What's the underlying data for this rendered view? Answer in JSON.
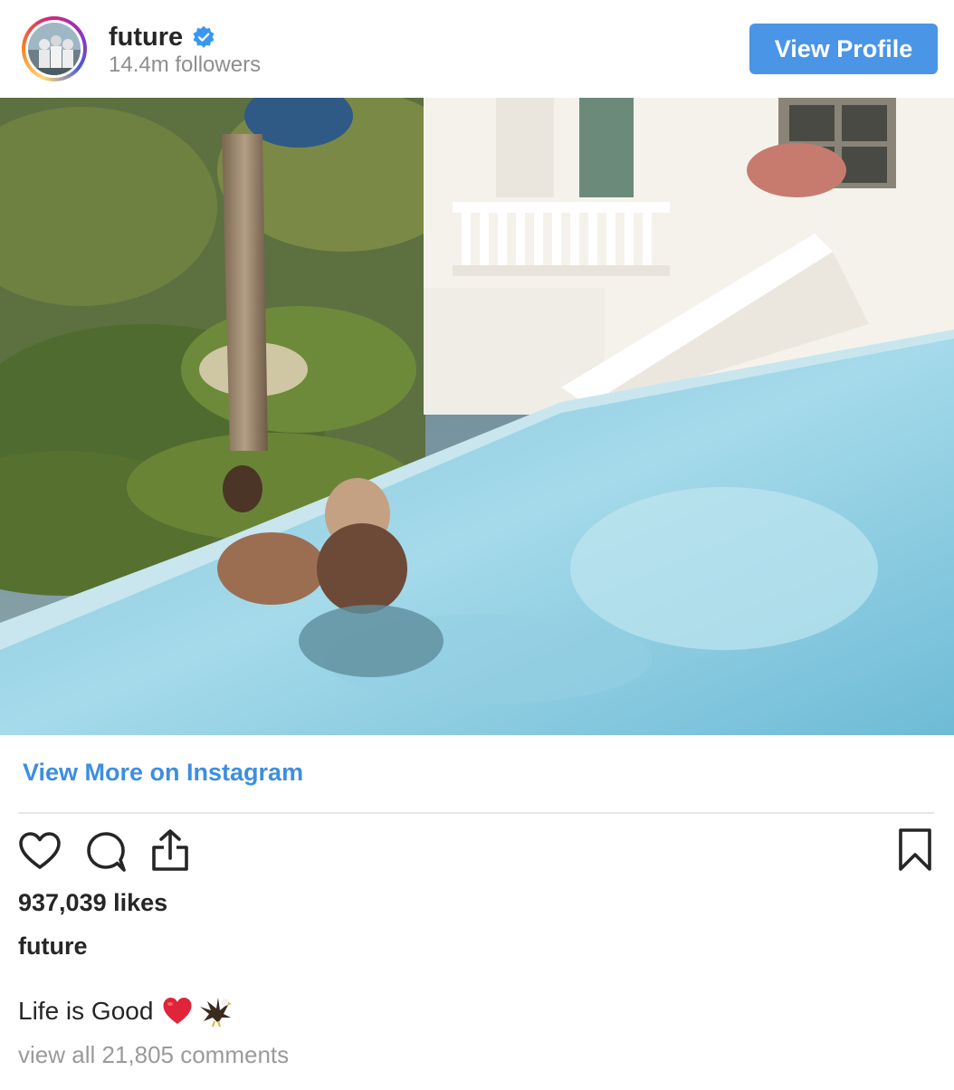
{
  "header": {
    "username": "future",
    "verified": true,
    "followers": "14.4m followers",
    "view_profile_label": "View Profile"
  },
  "post": {
    "view_more_label": "View More on Instagram",
    "likes": "937,039 likes",
    "author": "future",
    "caption": "Life is Good",
    "caption_emojis": [
      "red-heart",
      "eagle"
    ],
    "comments_link": "view all 21,805 comments"
  },
  "icons": {
    "like": "heart-outline-icon",
    "comment": "speech-bubble-icon",
    "share": "share-upload-icon",
    "save": "bookmark-icon"
  },
  "colors": {
    "button_blue": "#4a95e6",
    "link_blue": "#3e8ee0",
    "muted_text": "#8e8e8e",
    "verified_blue": "#3897f0"
  }
}
